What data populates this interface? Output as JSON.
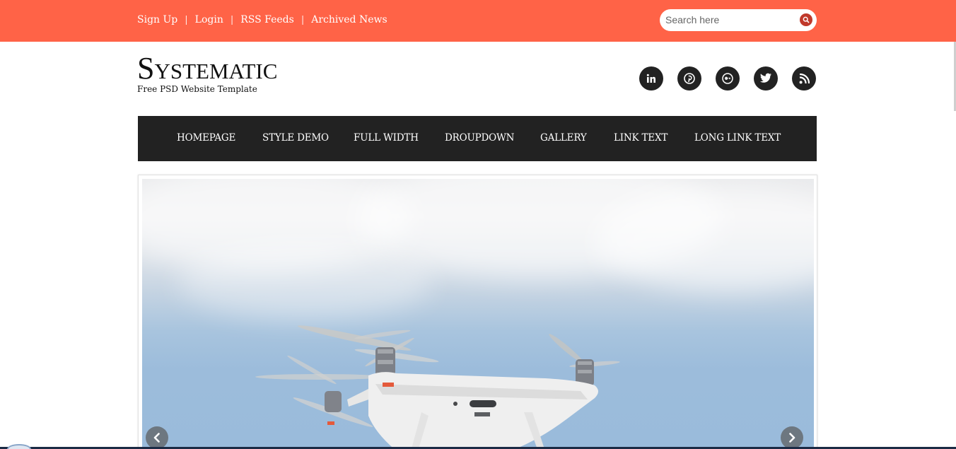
{
  "topbar": {
    "links": [
      "Sign Up",
      "Login",
      "RSS Feeds",
      "Archived News"
    ],
    "separator": "|",
    "search": {
      "placeholder": "Search here",
      "icon": "search-icon"
    }
  },
  "brand": {
    "title": "Systematic",
    "tagline": "Free PSD Website Template"
  },
  "social": [
    "linkedin-icon",
    "pinterest-icon",
    "google-plus-icon",
    "twitter-icon",
    "rss-icon"
  ],
  "nav": {
    "items": [
      "HOMEPAGE",
      "STYLE DEMO",
      "FULL WIDTH",
      "DROUPDOWN",
      "GALLERY",
      "LINK TEXT",
      "LONG LINK TEXT"
    ]
  },
  "slider": {
    "prev_icon": "chevron-left-icon",
    "next_icon": "chevron-right-icon"
  },
  "colors": {
    "accent": "#ff6347",
    "nav_bg": "#222222",
    "search_button": "#c0392b"
  }
}
